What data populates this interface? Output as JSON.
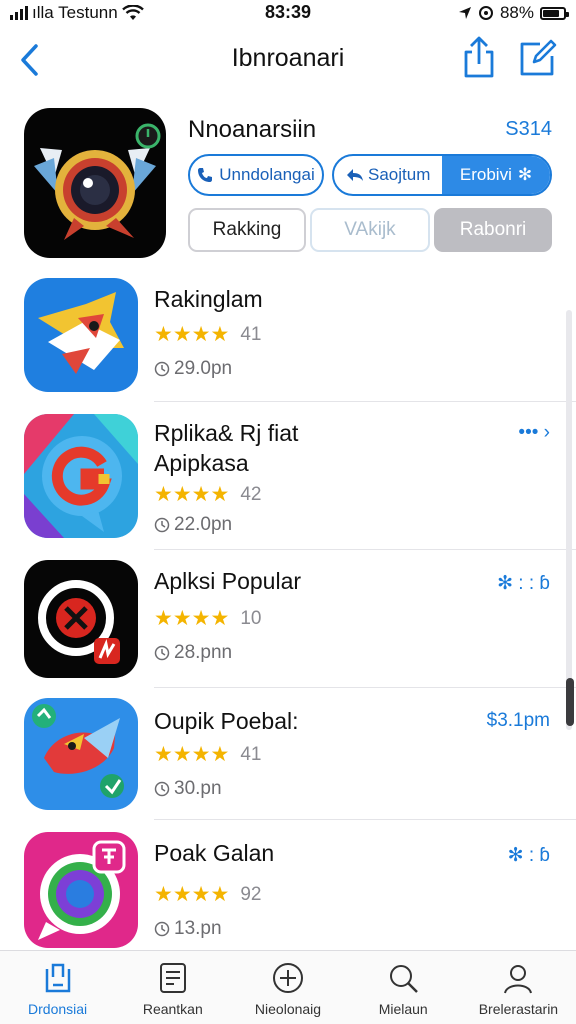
{
  "status_bar": {
    "carrier": "ılla Testunn",
    "time": "83:39",
    "battery": "88%"
  },
  "nav": {
    "title": "Ibnroanari"
  },
  "featured": {
    "name": "Nnoanarsiin",
    "price": "S314",
    "pill_1": "Unndolangai",
    "pill_2a": "Saojtum",
    "pill_2b": "Erobivi",
    "seg_1": "Rakking",
    "seg_2": "VAkijk",
    "seg_3": "Rabonri"
  },
  "apps": [
    {
      "title": "Rakinglam",
      "title2": "",
      "rating_count": "41",
      "time": "29.0pn",
      "action": ""
    },
    {
      "title": "Rplika& Rj fiat",
      "title2": "Apipkasa",
      "rating_count": "42",
      "time": "22.0pn",
      "action": "•••"
    },
    {
      "title": "Aplksi Popular",
      "title2": "",
      "rating_count": "10",
      "time": "28.pnn",
      "action": "✻ : : ɓ"
    },
    {
      "title": "Oupik Poebal:",
      "title2": "",
      "rating_count": "41",
      "time": "30.pn",
      "action": "$3.1pm"
    },
    {
      "title": "Poak Galan",
      "title2": "",
      "rating_count": "92",
      "time": "13.pn",
      "action": "✻ : ɓ"
    }
  ],
  "tabs": [
    {
      "label": "Drdonsiai",
      "icon": "today-icon",
      "active": true
    },
    {
      "label": "Reantkan",
      "icon": "document-icon",
      "active": false
    },
    {
      "label": "Nieolonaig",
      "icon": "plus-circle-icon",
      "active": false
    },
    {
      "label": "Mielaun",
      "icon": "search-icon",
      "active": false
    },
    {
      "label": "Brelerastarin",
      "icon": "account-icon",
      "active": false
    }
  ],
  "colors": {
    "accent": "#1a7ad9",
    "star": "#f4b400"
  }
}
